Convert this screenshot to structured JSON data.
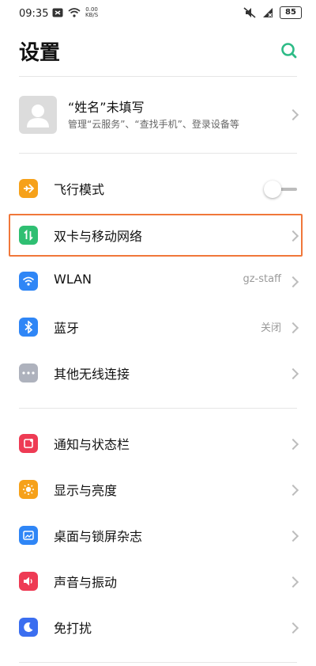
{
  "status_bar": {
    "time": "09:35",
    "speed_value": "0.00",
    "speed_unit": "KB/S",
    "battery": "85",
    "icons": [
      "notification-icon",
      "wifi-icon",
      "mute-icon",
      "signal-off-icon"
    ]
  },
  "header": {
    "title": "设置",
    "search_icon": "search-icon",
    "accent": "#2dbb86"
  },
  "profile": {
    "name": "“姓名”未填写",
    "subtitle": "管理“云服务”、“查找手机”、登录设备等"
  },
  "settings": [
    {
      "label": "飞行模式",
      "icon": "airplane-icon",
      "color": "#f6a11a",
      "control": "toggle",
      "on": false
    },
    {
      "label": "双卡与移动网络",
      "icon": "dual-sim-icon",
      "color": "#2fbf72",
      "highlighted": true
    },
    {
      "label": "WLAN",
      "icon": "wifi-icon",
      "color": "#2f86f6",
      "value": "gz-staff"
    },
    {
      "label": "蓝牙",
      "icon": "bluetooth-icon",
      "color": "#2f86f6",
      "value": "关闭"
    },
    {
      "label": "其他无线连接",
      "icon": "more-icon",
      "color": "#aeb2bd"
    },
    {
      "label": "通知与状态栏",
      "icon": "notification-icon",
      "color": "#ee3b54"
    },
    {
      "label": "显示与亮度",
      "icon": "brightness-icon",
      "color": "#f6a11a"
    },
    {
      "label": "桌面与锁屏杂志",
      "icon": "wallpaper-icon",
      "color": "#2f86f6"
    },
    {
      "label": "声音与振动",
      "icon": "sound-icon",
      "color": "#ee3b54"
    },
    {
      "label": "免打扰",
      "icon": "moon-icon",
      "color": "#3b6ef0"
    }
  ],
  "highlight_color": "#f0773a"
}
